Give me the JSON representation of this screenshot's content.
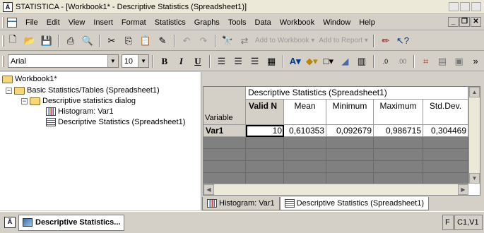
{
  "window": {
    "title": "STATISTICA - [Workbook1* - Descriptive Statistics (Spreadsheet1)]",
    "app_icon": "Ä"
  },
  "menu": [
    "File",
    "Edit",
    "View",
    "Insert",
    "Format",
    "Statistics",
    "Graphs",
    "Tools",
    "Data",
    "Workbook",
    "Window",
    "Help"
  ],
  "toolbar": {
    "add_to_workbook": "Add to Workbook",
    "add_to_report": "Add to Report"
  },
  "format_toolbar": {
    "font_name": "Arial",
    "font_size": "10"
  },
  "tree": {
    "root": "Workbook1*",
    "analysis": "Basic Statistics/Tables (Spreadsheet1)",
    "dialog": "Descriptive statistics dialog",
    "histogram": "Histogram: Var1",
    "spreadsheet": "Descriptive Statistics (Spreadsheet1)"
  },
  "spreadsheet": {
    "title": "Descriptive Statistics (Spreadsheet1)",
    "row_header_label": "Variable",
    "columns": [
      "Valid N",
      "Mean",
      "Minimum",
      "Maximum",
      "Std.Dev."
    ],
    "rows": [
      {
        "name": "Var1",
        "values": [
          "10",
          "0,610353",
          "0,092679",
          "0,986715",
          "0,304469"
        ]
      }
    ]
  },
  "tabs": [
    "Histogram: Var1",
    "Descriptive Statistics (Spreadsheet1)"
  ],
  "taskbar": {
    "task_label": "Descriptive Statistics...",
    "status_letter": "F",
    "status_cell": "C1,V1"
  }
}
